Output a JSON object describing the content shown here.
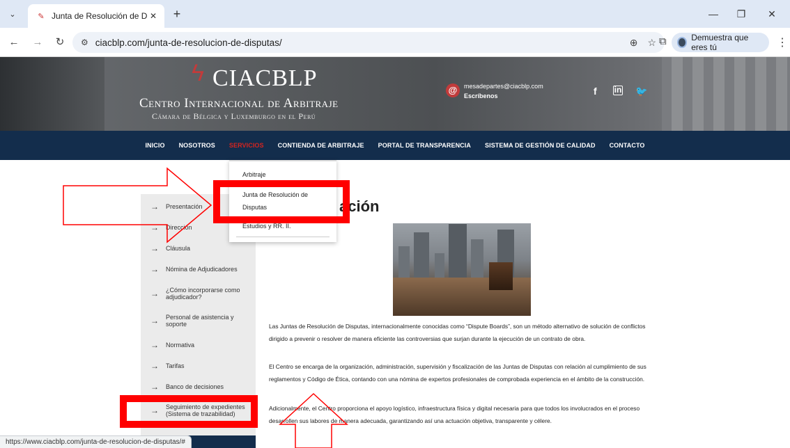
{
  "browser": {
    "tab_title": "Junta de Resolución de Disputa",
    "url": "ciacblp.com/junta-de-resolucion-de-disputas/",
    "profile_label": "Demuestra que eres tú",
    "status_url": "https://www.ciacblp.com/junta-de-resolucion-de-disputas/#"
  },
  "header": {
    "logo_name": "CIACBLP",
    "logo_line1": "Centro Internacional de Arbitraje",
    "logo_line2": "Cámara de Bélgica y Luxemburgo en el Perú",
    "email": "mesadepartes@ciacblp.com",
    "cta": "Escríbenos"
  },
  "nav": {
    "items": [
      "INICIO",
      "NOSOTROS",
      "SERVICIOS",
      "CONTIENDA DE ARBITRAJE",
      "PORTAL DE TRANSPARENCIA",
      "SISTEMA DE GESTIÓN DE CALIDAD",
      "CONTACTO"
    ],
    "active": "SERVICIOS"
  },
  "dropdown": {
    "item1": "Arbitraje",
    "item2_line1": "Junta de Resolución de",
    "item2_line2": "Disputas",
    "item3": "Estudios y RR. II."
  },
  "sidebar": {
    "s1": "Presentación",
    "s2": "Dirección",
    "s3": "Cláusula",
    "s4": "Nómina de Adjudicadores",
    "s5a": "¿Cómo incorporarse como",
    "s5b": "adjudicador?",
    "s6a": "Personal de asistencia y",
    "s6b": "soporte",
    "s7": "Normativa",
    "s8": "Tarifas",
    "s9": "Banco de decisiones",
    "s10a": "Seguimiento de expedientes",
    "s10b": "(Sistema de trazabilidad)"
  },
  "content": {
    "title_visible": "ación",
    "p1": "Las Juntas de Resolución de Disputas, internacionalmente conocidas como “Dispute Boards”, son un método alternativo de solución de conflictos dirigido a prevenir o resolver de manera eficiente las controversias que surjan durante la ejecución de un contrato de obra.",
    "p2": "El Centro se encarga de la organización, administración, supervisión y fiscalización de las Juntas de Disputas con relación al cumplimiento de sus reglamentos y Código de Ética, contando con una nómina de expertos profesionales de comprobada experiencia en el ámbito de la construcción.",
    "p3": "Adicionalmente, el Centro proporciona el apoyo logístico, infraestructura física y digital necesaria para que todos los involucrados en el proceso desarrollen sus labores de manera adecuada, garantizando así una actuación objetiva, transparente y célere."
  },
  "colors": {
    "nav_bg": "#132d4c",
    "accent_red": "#d4241f",
    "annotation_red": "#ff0000"
  }
}
